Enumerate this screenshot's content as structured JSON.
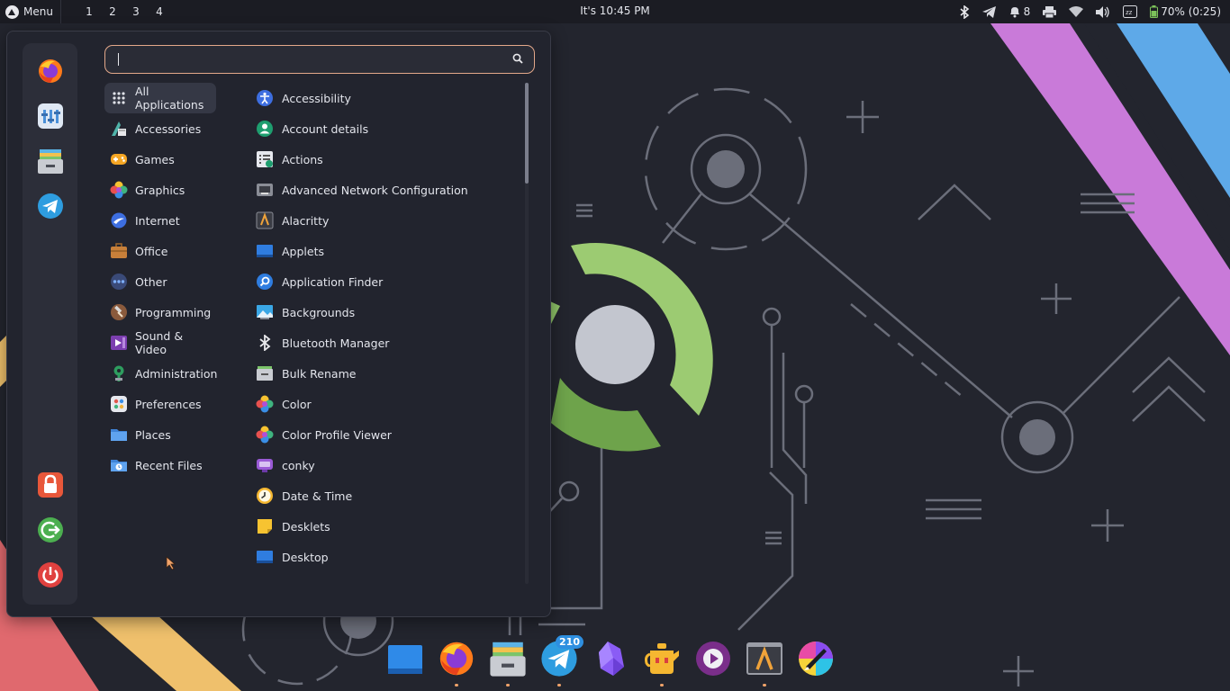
{
  "top_panel": {
    "menu_label": "Menu",
    "workspaces": [
      "1",
      "2",
      "3",
      "4"
    ],
    "clock": "It's 10:45 PM",
    "tray": {
      "notifications_count": "8",
      "battery": "70% (0:25)"
    }
  },
  "menu": {
    "search": {
      "value": "",
      "placeholder": ""
    },
    "favorites": [
      "firefox-icon",
      "mixer-icon",
      "file-manager-icon",
      "telegram-icon"
    ],
    "session": [
      "lock-screen-icon",
      "logout-icon",
      "shutdown-icon"
    ],
    "categories": [
      {
        "label": "All Applications"
      },
      {
        "label": "Accessories"
      },
      {
        "label": "Games"
      },
      {
        "label": "Graphics"
      },
      {
        "label": "Internet"
      },
      {
        "label": "Office"
      },
      {
        "label": "Other"
      },
      {
        "label": "Programming"
      },
      {
        "label": "Sound & Video"
      },
      {
        "label": "Administration"
      },
      {
        "label": "Preferences"
      },
      {
        "label": "Places"
      },
      {
        "label": "Recent Files"
      }
    ],
    "selected_category": "All Applications",
    "apps": [
      {
        "label": "Accessibility"
      },
      {
        "label": "Account details"
      },
      {
        "label": "Actions"
      },
      {
        "label": "Advanced Network Configuration"
      },
      {
        "label": "Alacritty"
      },
      {
        "label": "Applets"
      },
      {
        "label": "Application Finder"
      },
      {
        "label": "Backgrounds"
      },
      {
        "label": "Bluetooth Manager"
      },
      {
        "label": "Bulk Rename"
      },
      {
        "label": "Color"
      },
      {
        "label": "Color Profile Viewer"
      },
      {
        "label": "conky"
      },
      {
        "label": "Date & Time"
      },
      {
        "label": "Desklets"
      },
      {
        "label": "Desktop"
      }
    ]
  },
  "dock": {
    "telegram_badge": "210",
    "items": [
      "show-desktop-icon",
      "firefox-icon",
      "file-manager-icon",
      "telegram-icon",
      "obsidian-icon",
      "teapot-icon",
      "media-player-icon",
      "alacritty-icon",
      "krita-icon"
    ]
  },
  "colors": {
    "accent_search_border": "#e3a88a",
    "panel_bg": "#1b1c23",
    "menu_bg": "#22242e",
    "wallpaper_bg": "#23252e",
    "stripe_pink": "#c97ad9",
    "stripe_blue": "#5ea9e8",
    "stripe_red": "#e0696e",
    "stripe_yellow": "#efc06c",
    "ring_green": "#8fc569"
  }
}
